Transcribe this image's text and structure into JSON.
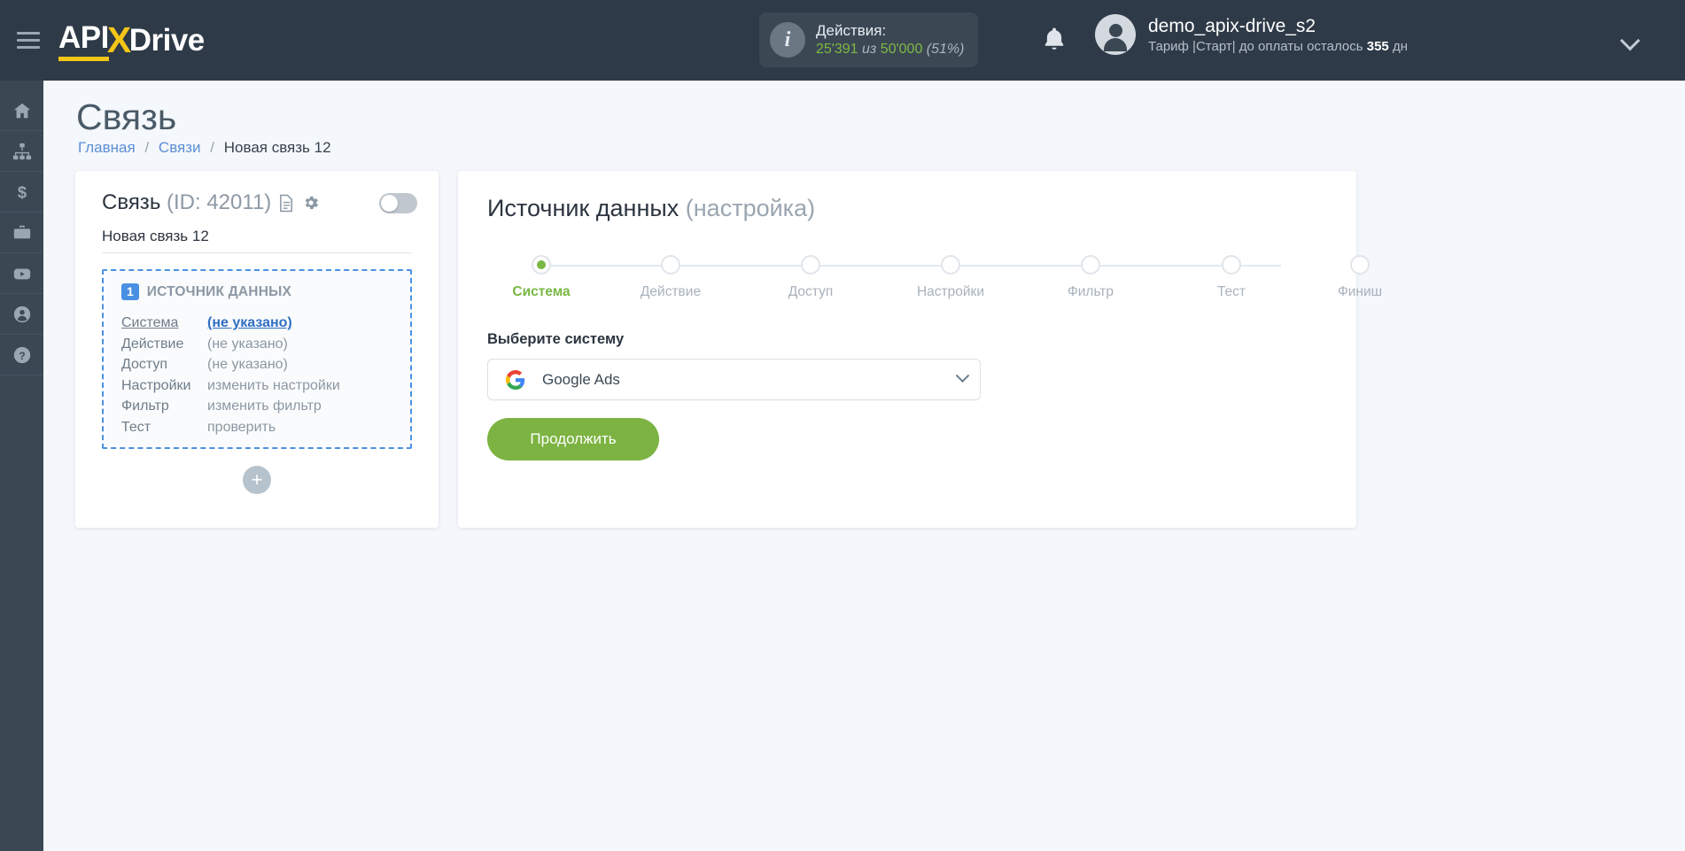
{
  "header": {
    "logo": {
      "part1": "API",
      "part2": "X",
      "part3": "Drive"
    },
    "actions": {
      "title": "Действия:",
      "used": "25'391",
      "of": "из",
      "total": "50'000",
      "percent": "(51%)"
    },
    "user": {
      "name": "demo_apix-drive_s2",
      "plan_prefix": "Тариф |Старт| до оплаты осталось",
      "days": "355",
      "days_suffix": "дн"
    }
  },
  "sidebar": {
    "items": [
      {
        "name": "home-icon"
      },
      {
        "name": "connections-icon"
      },
      {
        "name": "billing-icon"
      },
      {
        "name": "briefcase-icon"
      },
      {
        "name": "youtube-icon"
      },
      {
        "name": "profile-icon"
      },
      {
        "name": "help-icon"
      }
    ]
  },
  "page": {
    "title": "Связь",
    "breadcrumb": {
      "home": "Главная",
      "connections": "Связи",
      "current": "Новая связь 12",
      "separator": "/"
    }
  },
  "connection_card": {
    "title": "Связь",
    "id_label": "(ID: 42011)",
    "name_value": "Новая связь 12",
    "toggle_state": "off",
    "block": {
      "number": "1",
      "title": "ИСТОЧНИК ДАННЫХ",
      "rows": [
        {
          "key": "Система",
          "value": "(не указано)"
        },
        {
          "key": "Действие",
          "value": "(не указано)"
        },
        {
          "key": "Доступ",
          "value": "(не указано)"
        },
        {
          "key": "Настройки",
          "value": "изменить настройки"
        },
        {
          "key": "Фильтр",
          "value": "изменить фильтр"
        },
        {
          "key": "Тест",
          "value": "проверить"
        }
      ]
    },
    "add_label": "+"
  },
  "setup_panel": {
    "title": "Источник данных",
    "title_muted": "(настройка)",
    "steps": [
      {
        "label": "Система",
        "active": true
      },
      {
        "label": "Действие",
        "active": false
      },
      {
        "label": "Доступ",
        "active": false
      },
      {
        "label": "Настройки",
        "active": false
      },
      {
        "label": "Фильтр",
        "active": false
      },
      {
        "label": "Тест",
        "active": false
      },
      {
        "label": "Финиш",
        "active": false
      }
    ],
    "field_label": "Выберите систему",
    "selected_system": "Google Ads",
    "continue_label": "Продолжить"
  },
  "colors": {
    "topbar": "#2e3a47",
    "rail": "#3b4854",
    "accent_yellow": "#f5c518",
    "accent_green": "#7cb342",
    "accent_blue": "#4a90e2",
    "page_bg": "#f4f7fb"
  }
}
